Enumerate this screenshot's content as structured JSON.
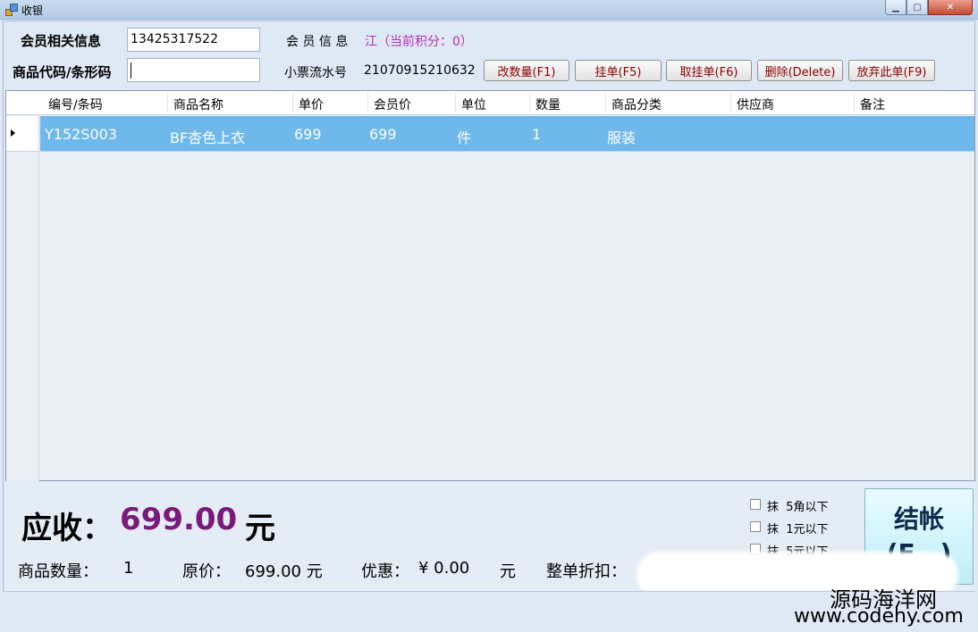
{
  "window": {
    "title": "收银"
  },
  "member": {
    "label": "会员相关信息",
    "phone": "13425317522",
    "info_label": "会 员 信 息",
    "info_value": "江（当前积分：0）"
  },
  "product": {
    "label": "商品代码/条形码",
    "value": ""
  },
  "receipt": {
    "label": "小票流水号",
    "number": "21070915210632"
  },
  "toolbar": {
    "change_qty": "改数量(F1)",
    "hold": "挂单(F5)",
    "retrieve": "取挂单(F6)",
    "delete": "删除(Delete)",
    "discard": "放弃此单(F9)"
  },
  "grid": {
    "columns": [
      "编号/条码",
      "商品名称",
      "单价",
      "会员价",
      "单位",
      "数量",
      "商品分类",
      "供应商",
      "备注"
    ],
    "rows": [
      [
        "Y152S003",
        "BF杏色上衣",
        "699",
        "699",
        "件",
        "1",
        "服装",
        "",
        ""
      ]
    ]
  },
  "summary": {
    "due_label": "应收：",
    "due_value": "699.00",
    "due_unit": "元",
    "qty_label": "商品数量：",
    "qty_value": "1",
    "orig_label": "原价：",
    "orig_value": "699.00 元",
    "discount_label": "优惠：",
    "discount_value": "¥ 0.00",
    "discount_unit": "元",
    "order_discount_label": "整单折扣："
  },
  "rounding": {
    "label_prefix": "抹",
    "opt1": "5角以下",
    "opt2": "1元以下",
    "opt3": "5元以下"
  },
  "checkout": {
    "line1": "结帐",
    "line2": "(F...)"
  },
  "watermark": {
    "line1": "源码海洋网",
    "line2": "www.codehy.com"
  }
}
